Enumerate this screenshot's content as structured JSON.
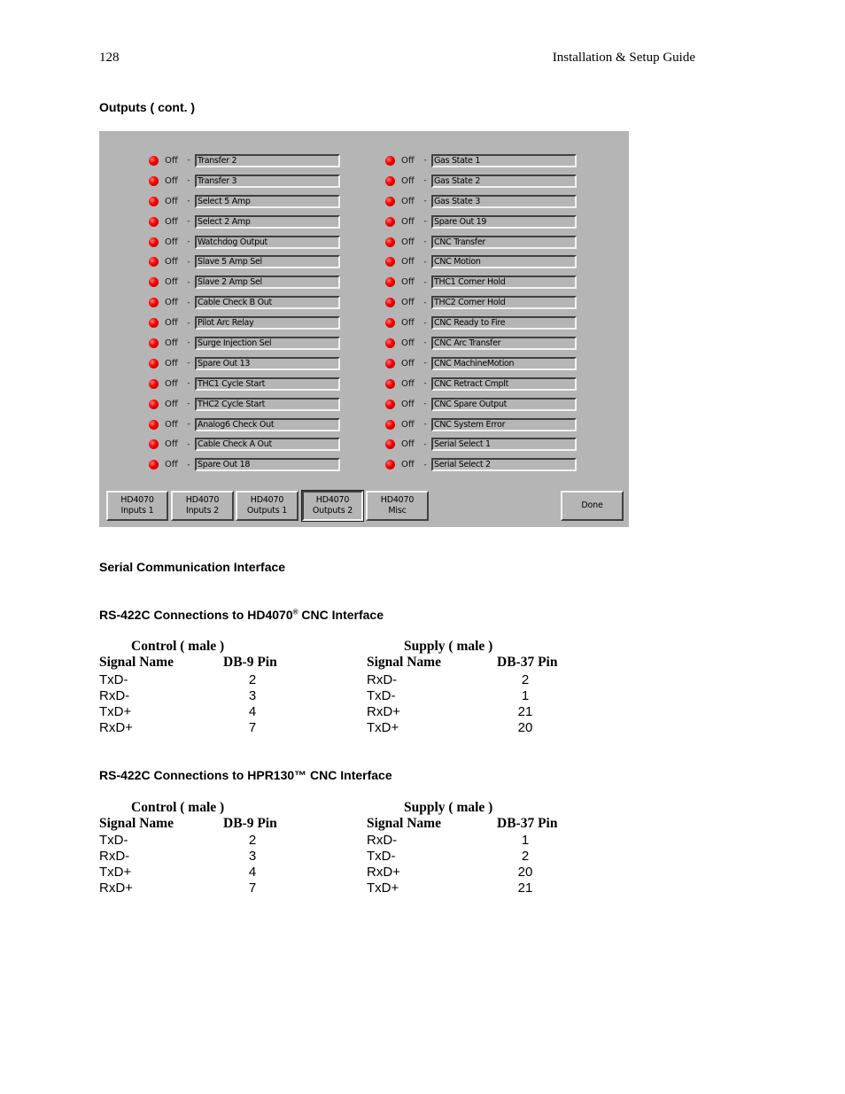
{
  "header": {
    "page_number": "128",
    "guide_title": "Installation & Setup Guide"
  },
  "section_outputs": {
    "heading": "Outputs ( cont. )"
  },
  "panel": {
    "left_outputs": [
      {
        "state": "Off",
        "label": "Transfer 2"
      },
      {
        "state": "Off",
        "label": "Transfer 3"
      },
      {
        "state": "Off",
        "label": "Select 5 Amp"
      },
      {
        "state": "Off",
        "label": "Select 2 Amp"
      },
      {
        "state": "Off",
        "label": "Watchdog Output"
      },
      {
        "state": "Off",
        "label": "Slave 5 Amp Sel"
      },
      {
        "state": "Off",
        "label": "Slave 2 Amp Sel"
      },
      {
        "state": "Off",
        "label": "Cable Check B Out"
      },
      {
        "state": "Off",
        "label": "Pilot Arc Relay"
      },
      {
        "state": "Off",
        "label": "Surge Injection Sel"
      },
      {
        "state": "Off",
        "label": "Spare Out 13"
      },
      {
        "state": "Off",
        "label": "THC1 Cycle Start"
      },
      {
        "state": "Off",
        "label": "THC2 Cycle Start"
      },
      {
        "state": "Off",
        "label": "Analog6 Check Out"
      },
      {
        "state": "Off",
        "label": "Cable Check A Out"
      },
      {
        "state": "Off",
        "label": "Spare Out 18"
      }
    ],
    "right_outputs": [
      {
        "state": "Off",
        "label": "Gas State 1"
      },
      {
        "state": "Off",
        "label": "Gas State 2"
      },
      {
        "state": "Off",
        "label": "Gas State 3"
      },
      {
        "state": "Off",
        "label": "Spare Out 19"
      },
      {
        "state": "Off",
        "label": "CNC Transfer"
      },
      {
        "state": "Off",
        "label": "CNC Motion"
      },
      {
        "state": "Off",
        "label": "THC1 Corner Hold"
      },
      {
        "state": "Off",
        "label": "THC2 Corner Hold"
      },
      {
        "state": "Off",
        "label": "CNC Ready to Fire"
      },
      {
        "state": "Off",
        "label": "CNC Arc Transfer"
      },
      {
        "state": "Off",
        "label": "CNC MachineMotion"
      },
      {
        "state": "Off",
        "label": "CNC Retract Cmplt"
      },
      {
        "state": "Off",
        "label": "CNC Spare Output"
      },
      {
        "state": "Off",
        "label": "CNC System Error"
      },
      {
        "state": "Off",
        "label": "Serial Select 1"
      },
      {
        "state": "Off",
        "label": "Serial Select 2"
      }
    ],
    "separator": "-",
    "led_color": "#ff0000",
    "tabs": [
      {
        "line1": "HD4070",
        "line2": "Inputs 1",
        "active": false
      },
      {
        "line1": "HD4070",
        "line2": "Inputs 2",
        "active": false
      },
      {
        "line1": "HD4070",
        "line2": "Outputs 1",
        "active": false
      },
      {
        "line1": "HD4070",
        "line2": "Outputs 2",
        "active": true
      },
      {
        "line1": "HD4070",
        "line2": "Misc",
        "active": false
      }
    ],
    "done_label": "Done"
  },
  "section_serial": {
    "heading": "Serial Communication Interface"
  },
  "table_hd4070": {
    "heading_prefix": "RS-422C Connections to HD4070",
    "heading_mark": "®",
    "heading_suffix": " CNC Interface",
    "control_title": "Control ( male )",
    "supply_title": "Supply ( male )",
    "control_headers": [
      "Signal Name",
      "DB-9 Pin"
    ],
    "supply_headers": [
      "Signal Name",
      "DB-37 Pin"
    ],
    "control_rows": [
      [
        "TxD-",
        "2"
      ],
      [
        "RxD-",
        "3"
      ],
      [
        "TxD+",
        "4"
      ],
      [
        "RxD+",
        "7"
      ]
    ],
    "supply_rows": [
      [
        "RxD-",
        "2"
      ],
      [
        "TxD-",
        "1"
      ],
      [
        "RxD+",
        "21"
      ],
      [
        "TxD+",
        "20"
      ]
    ]
  },
  "table_hpr130": {
    "heading": "RS-422C Connections to HPR130™ CNC Interface",
    "control_title": "Control ( male )",
    "supply_title": "Supply ( male )",
    "control_headers": [
      "Signal Name",
      "DB-9 Pin"
    ],
    "supply_headers": [
      "Signal Name",
      "DB-37 Pin"
    ],
    "control_rows": [
      [
        "TxD-",
        "2"
      ],
      [
        "RxD-",
        "3"
      ],
      [
        "TxD+",
        "4"
      ],
      [
        "RxD+",
        "7"
      ]
    ],
    "supply_rows": [
      [
        "RxD-",
        "1"
      ],
      [
        "TxD-",
        "2"
      ],
      [
        "RxD+",
        "20"
      ],
      [
        "TxD+",
        "21"
      ]
    ]
  }
}
